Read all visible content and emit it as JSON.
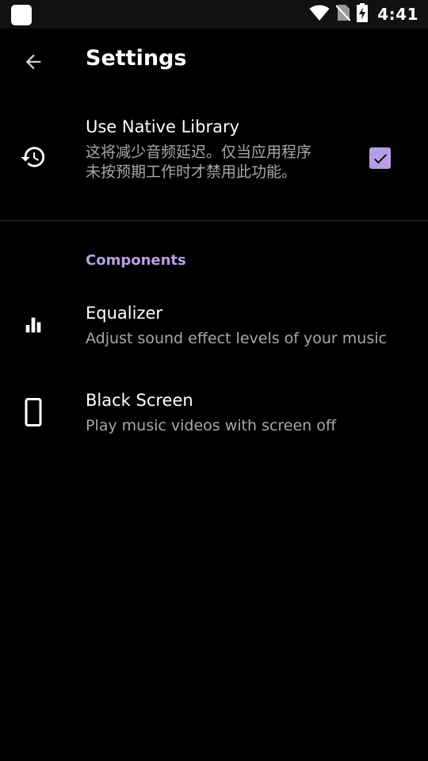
{
  "status_bar": {
    "time": "4:41"
  },
  "toolbar": {
    "title": "Settings"
  },
  "native_library": {
    "title": "Use Native Library",
    "summary": "这将减少音频延迟。仅当应用程序未按预期工作时才禁用此功能。",
    "checked": true
  },
  "components": {
    "header": "Components",
    "items": [
      {
        "title": "Equalizer",
        "summary": "Adjust sound effect levels of your music",
        "icon": "equalizer-icon"
      },
      {
        "title": "Black Screen",
        "summary": "Play music videos with screen off",
        "icon": "phone-icon"
      }
    ]
  },
  "colors": {
    "accent": "#b99ee6",
    "background": "#000000",
    "status_bar": "#111111",
    "summary_text": "#a8a8a8"
  }
}
